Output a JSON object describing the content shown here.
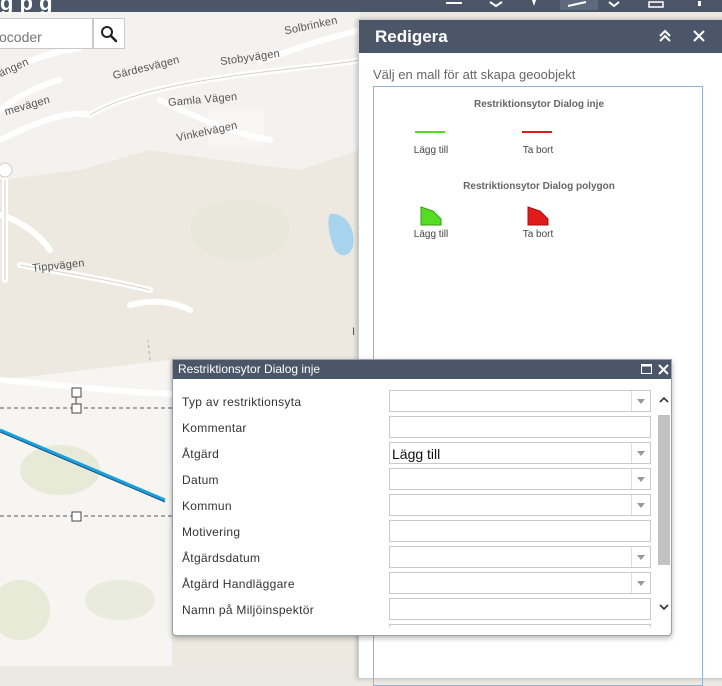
{
  "app": {
    "title_fragment": "g          p  g"
  },
  "search": {
    "placeholder": "ocoder"
  },
  "map_labels": {
    "solbrinken": "Solbrinken",
    "gardesvagen": "Gärdesvägen",
    "stobyvagen": "Stobyvägen",
    "gamla_vagen": "Gamla Vägen",
    "vinkelvagen": "Vinkelvägen",
    "angen": "ängen",
    "mevagen": "mevägen",
    "tippvagen": "Tippvägen",
    "partial_i": "I"
  },
  "edit_panel": {
    "title": "Redigera",
    "instruction": "Välj en mall för att skapa geoobjekt",
    "groups": [
      {
        "title": "Restriktionsytor Dialog inje",
        "items": [
          {
            "label": "Lägg till",
            "color": "#55dd22"
          },
          {
            "label": "Ta bort",
            "color": "#e11b1b"
          }
        ]
      },
      {
        "title": "Restriktionsytor Dialog polygon",
        "items": [
          {
            "label": "Lägg till",
            "color": "#55dd22"
          },
          {
            "label": "Ta bort",
            "color": "#e11b1b"
          }
        ]
      }
    ]
  },
  "dialog": {
    "title": "Restriktionsytor Dialog inje",
    "fields": [
      {
        "label": "Typ av restriktionsyta",
        "value": "",
        "dropdown": true
      },
      {
        "label": "Kommentar",
        "value": "",
        "dropdown": false
      },
      {
        "label": "Åtgärd",
        "value": "Lägg till",
        "dropdown": true
      },
      {
        "label": "Datum",
        "value": "",
        "dropdown": true
      },
      {
        "label": "Kommun",
        "value": "",
        "dropdown": true
      },
      {
        "label": "Motivering",
        "value": "",
        "dropdown": false
      },
      {
        "label": "Åtgärdsdatum",
        "value": "",
        "dropdown": true
      },
      {
        "label": "Åtgärd Handläggare",
        "value": "",
        "dropdown": true
      },
      {
        "label": "Namn på Miljöinspektör",
        "value": "",
        "dropdown": false
      }
    ]
  },
  "colors": {
    "header_bg": "#4b5769",
    "panel_border": "#8fb4d6",
    "selected_line": "#1aa0e0"
  }
}
